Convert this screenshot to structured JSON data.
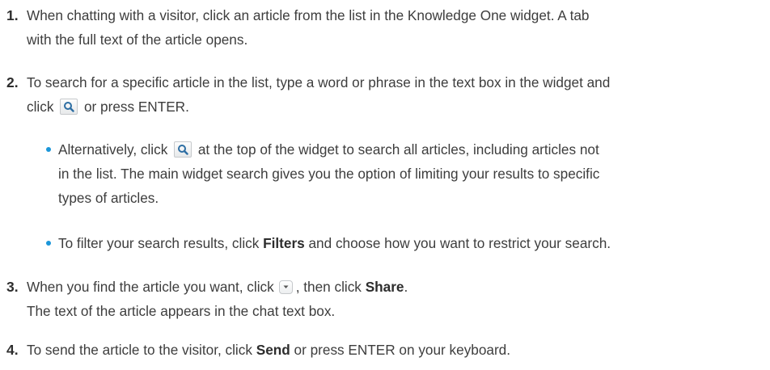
{
  "steps": [
    {
      "num": "1.",
      "lines": [
        "When chatting with a visitor, click an article from the list in the Knowledge One widget. A tab",
        "with the full text of the article opens."
      ]
    },
    {
      "num": "2.",
      "line1": "To search for a specific article in the list, type a word or phrase in the text box in the widget and",
      "line2_pre": "click",
      "line2_post": "or press ENTER."
    },
    {
      "num": "3.",
      "line1_pre": "When you find the article you want, click",
      "line1_mid": ", then click",
      "line1_bold": "Share",
      "line1_end": ".",
      "line2": "The text of the article appears in the chat text box."
    },
    {
      "num": "4.",
      "pre": "To send the article to the visitor, click",
      "bold": "Send",
      "post": "or press ENTER on your keyboard."
    }
  ],
  "bullets": [
    {
      "line1_pre": "Alternatively, click",
      "line1_post": "at the top of the widget to search all articles, including articles not",
      "line2": "in the list. The main widget search gives you the option of limiting your results to specific",
      "line3": "types of articles."
    },
    {
      "pre": "To filter your search results, click",
      "bold": "Filters",
      "post": "and choose how you want to restrict your search."
    }
  ],
  "icons": {
    "search": "search-icon",
    "dropdown": "chevron-down-icon"
  },
  "colors": {
    "bullet": "#1b96d9",
    "text": "#3d3d3d"
  }
}
